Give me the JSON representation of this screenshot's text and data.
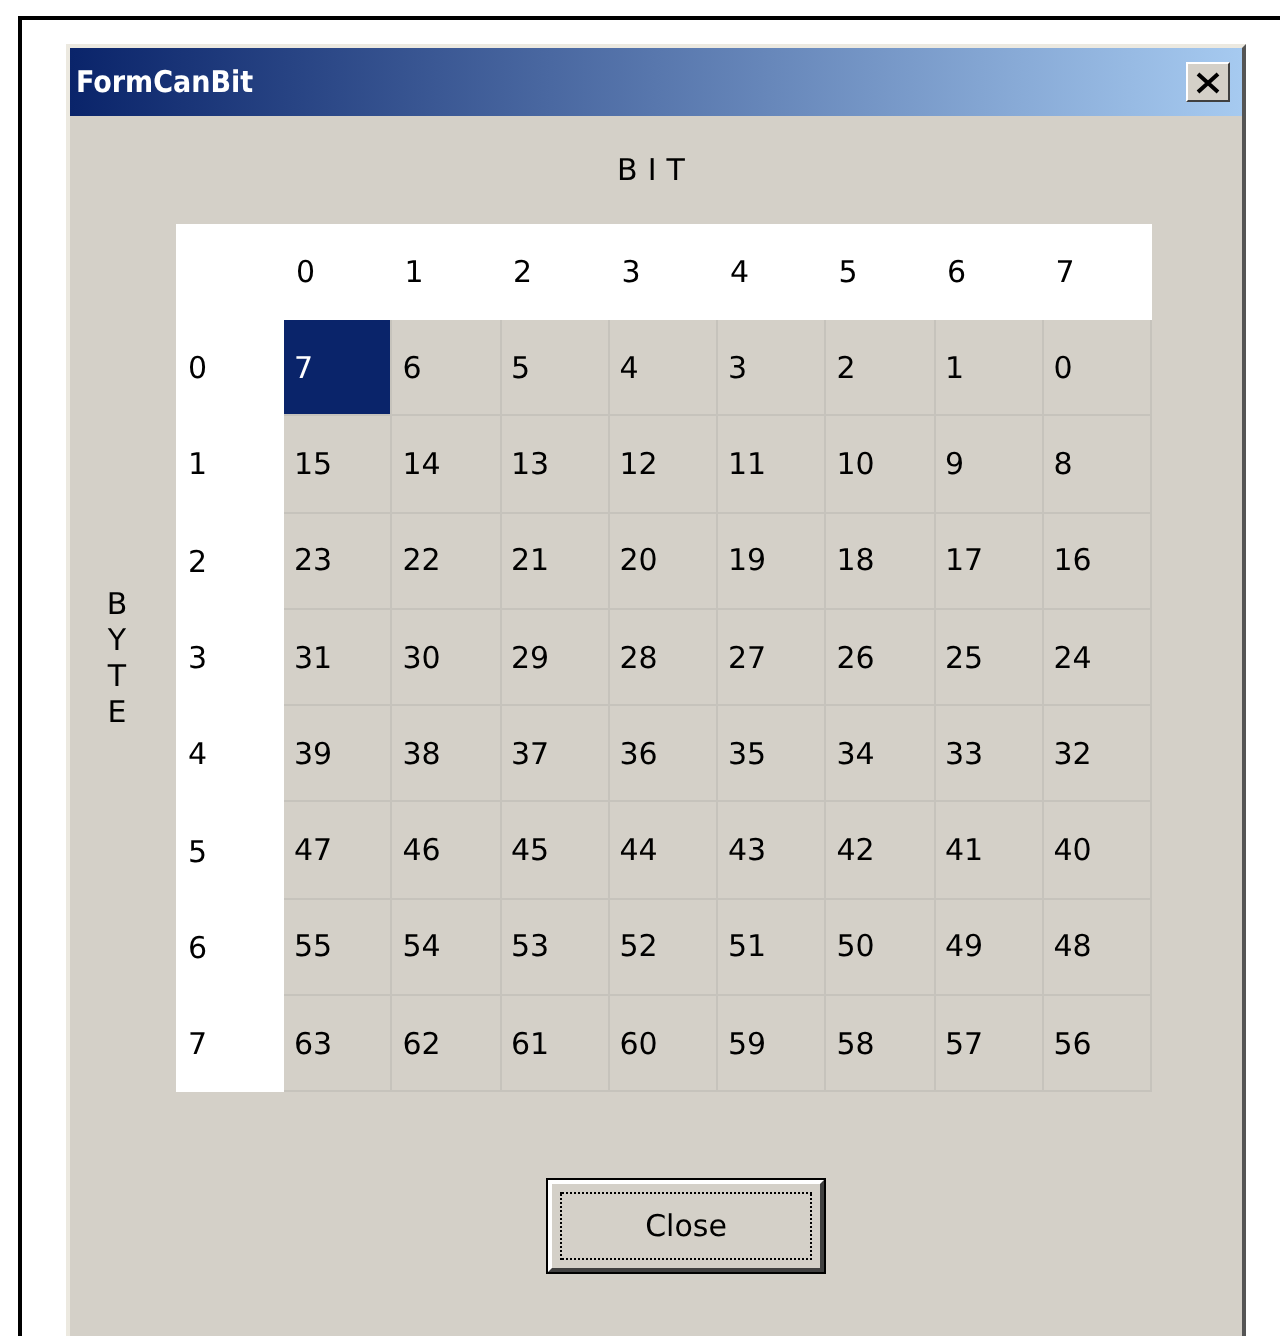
{
  "window": {
    "title": "FormCanBit"
  },
  "bit_label": "BIT",
  "byte_label": "BYTE",
  "columns": [
    "0",
    "1",
    "2",
    "3",
    "4",
    "5",
    "6",
    "7"
  ],
  "rows": [
    {
      "header": "0",
      "cells": [
        {
          "text": "7",
          "selected": true
        },
        {
          "text": "6",
          "selected": false
        },
        {
          "text": "5",
          "selected": false
        },
        {
          "text": "4",
          "selected": false
        },
        {
          "text": "3",
          "selected": false
        },
        {
          "text": "2",
          "selected": false
        },
        {
          "text": "1",
          "selected": false
        },
        {
          "text": "0",
          "selected": false
        }
      ]
    },
    {
      "header": "1",
      "cells": [
        {
          "text": "15",
          "selected": false
        },
        {
          "text": "14",
          "selected": false
        },
        {
          "text": "13",
          "selected": false
        },
        {
          "text": "12",
          "selected": false
        },
        {
          "text": "11",
          "selected": false
        },
        {
          "text": "10",
          "selected": false
        },
        {
          "text": "9",
          "selected": false
        },
        {
          "text": "8",
          "selected": false
        }
      ]
    },
    {
      "header": "2",
      "cells": [
        {
          "text": "23",
          "selected": false
        },
        {
          "text": "22",
          "selected": false
        },
        {
          "text": "21",
          "selected": false
        },
        {
          "text": "20",
          "selected": false
        },
        {
          "text": "19",
          "selected": false
        },
        {
          "text": "18",
          "selected": false
        },
        {
          "text": "17",
          "selected": false
        },
        {
          "text": "16",
          "selected": false
        }
      ]
    },
    {
      "header": "3",
      "cells": [
        {
          "text": "31",
          "selected": false
        },
        {
          "text": "30",
          "selected": false
        },
        {
          "text": "29",
          "selected": false
        },
        {
          "text": "28",
          "selected": false
        },
        {
          "text": "27",
          "selected": false
        },
        {
          "text": "26",
          "selected": false
        },
        {
          "text": "25",
          "selected": false
        },
        {
          "text": "24",
          "selected": false
        }
      ]
    },
    {
      "header": "4",
      "cells": [
        {
          "text": "39",
          "selected": false
        },
        {
          "text": "38",
          "selected": false
        },
        {
          "text": "37",
          "selected": false
        },
        {
          "text": "36",
          "selected": false
        },
        {
          "text": "35",
          "selected": false
        },
        {
          "text": "34",
          "selected": false
        },
        {
          "text": "33",
          "selected": false
        },
        {
          "text": "32",
          "selected": false
        }
      ]
    },
    {
      "header": "5",
      "cells": [
        {
          "text": "47",
          "selected": false
        },
        {
          "text": "46",
          "selected": false
        },
        {
          "text": "45",
          "selected": false
        },
        {
          "text": "44",
          "selected": false
        },
        {
          "text": "43",
          "selected": false
        },
        {
          "text": "42",
          "selected": false
        },
        {
          "text": "41",
          "selected": false
        },
        {
          "text": "40",
          "selected": false
        }
      ]
    },
    {
      "header": "6",
      "cells": [
        {
          "text": "55",
          "selected": false
        },
        {
          "text": "54",
          "selected": false
        },
        {
          "text": "53",
          "selected": false
        },
        {
          "text": "52",
          "selected": false
        },
        {
          "text": "51",
          "selected": false
        },
        {
          "text": "50",
          "selected": false
        },
        {
          "text": "49",
          "selected": false
        },
        {
          "text": "48",
          "selected": false
        }
      ]
    },
    {
      "header": "7",
      "cells": [
        {
          "text": "63",
          "selected": false
        },
        {
          "text": "62",
          "selected": false
        },
        {
          "text": "61",
          "selected": false
        },
        {
          "text": "60",
          "selected": false
        },
        {
          "text": "59",
          "selected": false
        },
        {
          "text": "58",
          "selected": false
        },
        {
          "text": "57",
          "selected": false
        },
        {
          "text": "56",
          "selected": false
        }
      ]
    }
  ],
  "buttons": [
    "Close"
  ]
}
